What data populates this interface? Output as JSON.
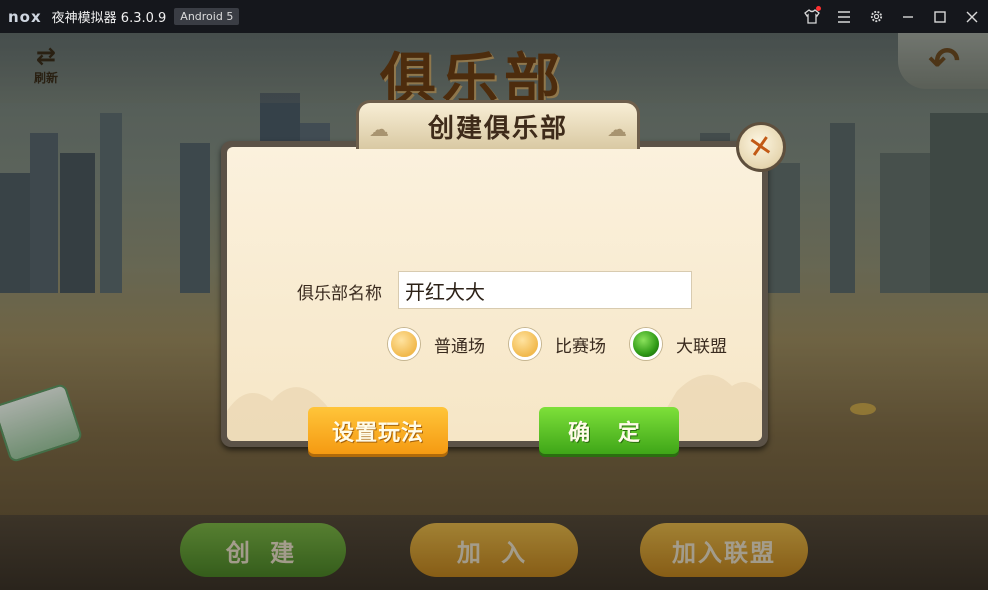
{
  "emulator": {
    "logo": "nox",
    "title": "夜神模拟器 6.3.0.9",
    "android_badge": "Android 5",
    "buttons": [
      "shirt-icon",
      "menu-icon",
      "settings-icon",
      "minimize-icon",
      "maximize-icon",
      "close-icon"
    ]
  },
  "game": {
    "refresh_label": "刷新",
    "page_title": "俱乐部",
    "bottom_buttons": {
      "create": "创 建",
      "join": "加 入",
      "join_alliance": "加入联盟"
    }
  },
  "dialog": {
    "title": "创建俱乐部",
    "name_label": "俱乐部名称",
    "name_value": "开红大大",
    "modes": [
      {
        "label": "普通场",
        "selected": false
      },
      {
        "label": "比赛场",
        "selected": false
      },
      {
        "label": "大联盟",
        "selected": true
      }
    ],
    "settings_button": "设置玩法",
    "confirm_button": "确 定"
  },
  "colors": {
    "accent_orange": "#f59a12",
    "accent_green": "#3fa618",
    "title_brown": "#6b3e12"
  }
}
